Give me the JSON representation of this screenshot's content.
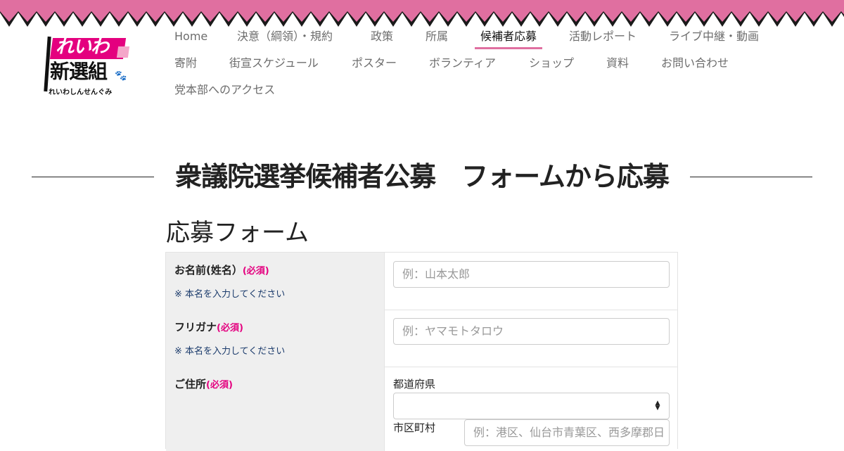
{
  "header": {
    "banner_color": "#e06fa0",
    "logo": {
      "line1": "れいわ",
      "line2": "新選組",
      "line3": "れいわしんせんぐみ",
      "accent_color": "#e4007f"
    }
  },
  "nav": {
    "row1": [
      "Home",
      "決意（綱領）・規約",
      "政策",
      "所属",
      "候補者応募",
      "活動レポート",
      "ライブ中継・動画"
    ],
    "row2": [
      "寄附",
      "街宣スケジュール",
      "ポスター",
      "ボランティア",
      "ショップ",
      "資料",
      "お問い合わせ"
    ],
    "row3": [
      "党本部へのアクセス"
    ],
    "active": "候補者応募"
  },
  "page": {
    "title": "衆議院選挙候補者公募　フォームから応募"
  },
  "form": {
    "title": "応募フォーム",
    "fields": [
      {
        "label": "お名前(姓名）",
        "required": "(必須)",
        "note": "※ 本名を入力してください",
        "placeholder": "例：山本太郎"
      },
      {
        "label": "フリガナ",
        "required": "(必須)",
        "note": "※ 本名を入力してください",
        "placeholder": "例：ヤマモトタロウ"
      },
      {
        "label": "ご住所",
        "required": "(必須)",
        "prefecture_label": "都道府県",
        "prefecture_value": "",
        "city_label": "市区町村",
        "city_placeholder": "例：港区、仙台市青葉区、西多摩郡日"
      }
    ]
  }
}
